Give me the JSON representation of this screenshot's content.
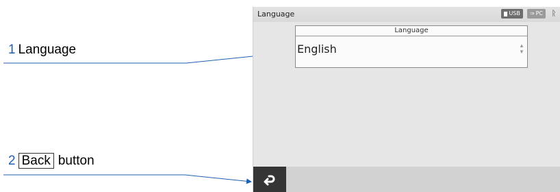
{
  "annotations": [
    {
      "number": "1",
      "text": "Language"
    },
    {
      "number": "2",
      "boxed": "Back",
      "text": "button"
    }
  ],
  "screen": {
    "title": "Language",
    "status": {
      "usb_label": "USB",
      "pc_label": "PC"
    },
    "panel": {
      "header": "Language",
      "selected_value": "English"
    },
    "back_icon": "back-arrow-icon"
  }
}
